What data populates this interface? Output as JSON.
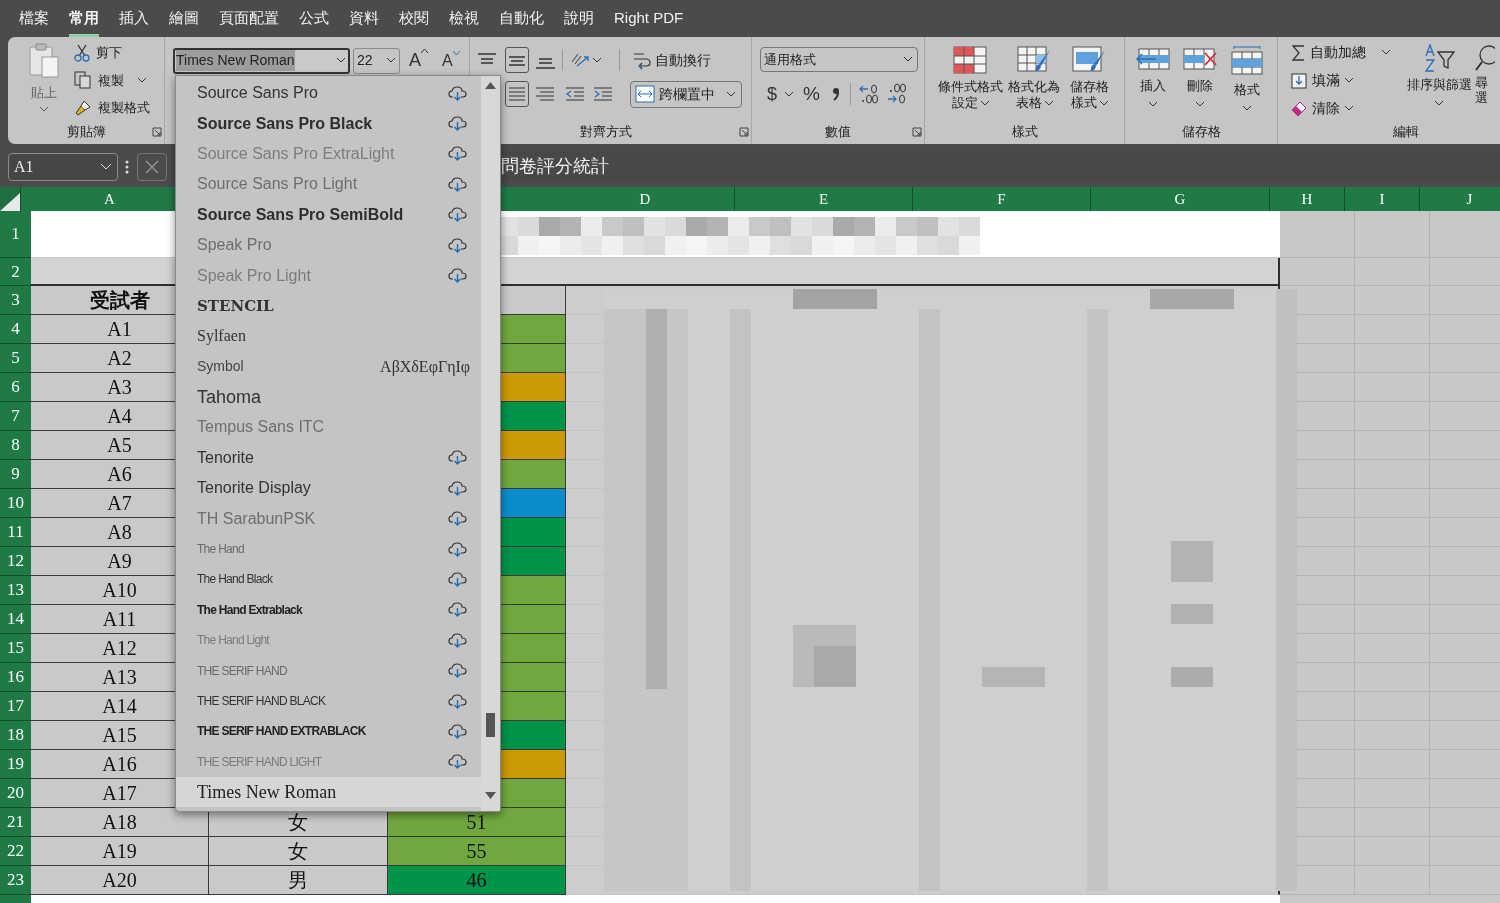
{
  "menu_tabs": [
    {
      "label": "檔案",
      "selected": false
    },
    {
      "label": "常用",
      "selected": true
    },
    {
      "label": "插入",
      "selected": false
    },
    {
      "label": "繪圖",
      "selected": false
    },
    {
      "label": "頁面配置",
      "selected": false
    },
    {
      "label": "公式",
      "selected": false
    },
    {
      "label": "資料",
      "selected": false
    },
    {
      "label": "校閱",
      "selected": false
    },
    {
      "label": "檢視",
      "selected": false
    },
    {
      "label": "自動化",
      "selected": false
    },
    {
      "label": "說明",
      "selected": false
    },
    {
      "label": "Right PDF",
      "selected": false
    }
  ],
  "ribbon": {
    "clipboard": {
      "paste": "貼上",
      "cut": "剪下",
      "copy": "複製",
      "format_painter": "複製格式",
      "label": "剪貼簿"
    },
    "font": {
      "font_name": "Times New Roman",
      "font_size": "22",
      "grow_font": "A",
      "shrink_font": "A"
    },
    "alignment": {
      "wrap_text": "自動換行",
      "merge_center": "跨欄置中",
      "label": "對齊方式"
    },
    "number": {
      "format": "通用格式",
      "currency": "$",
      "percent": "%",
      "label": "數值"
    },
    "styles": {
      "buttons": [
        {
          "lines": [
            "條件式格式",
            "設定"
          ]
        },
        {
          "lines": [
            "格式化為",
            "表格"
          ]
        },
        {
          "lines": [
            "儲存格",
            "樣式"
          ]
        }
      ],
      "label": "樣式"
    },
    "cells": {
      "buttons": [
        "插入",
        "刪除",
        "格式"
      ],
      "label": "儲存格"
    },
    "editing": {
      "autosum": "自動加總",
      "fill": "填滿",
      "clear": "清除",
      "sort_filter": "排序與篩選",
      "find_select": [
        "尋",
        "選"
      ],
      "label": "編輯"
    }
  },
  "formula_bar": {
    "name_box": "A1",
    "formula": "問卷評分統計"
  },
  "columns": [
    "A",
    "D",
    "E",
    "F",
    "G",
    "H",
    "I",
    "J"
  ],
  "rows": [
    {
      "number": "1"
    },
    {
      "number": "2"
    },
    {
      "number": "3",
      "a": "受試者"
    },
    {
      "number": "4",
      "a": "A1",
      "color": "#70a83f"
    },
    {
      "number": "5",
      "a": "A2",
      "color": "#70a83f"
    },
    {
      "number": "6",
      "a": "A3",
      "color": "#cc9a06"
    },
    {
      "number": "7",
      "a": "A4",
      "color": "#00934a"
    },
    {
      "number": "8",
      "a": "A5",
      "color": "#cc9a06"
    },
    {
      "number": "9",
      "a": "A6",
      "color": "#70a83f"
    },
    {
      "number": "10",
      "a": "A7",
      "color": "#0a8dca"
    },
    {
      "number": "11",
      "a": "A8",
      "color": "#00934a"
    },
    {
      "number": "12",
      "a": "A9",
      "color": "#00934a"
    },
    {
      "number": "13",
      "a": "A10",
      "color": "#70a83f"
    },
    {
      "number": "14",
      "a": "A11",
      "color": "#70a83f"
    },
    {
      "number": "15",
      "a": "A12",
      "color": "#70a83f"
    },
    {
      "number": "16",
      "a": "A13",
      "color": "#70a83f"
    },
    {
      "number": "17",
      "a": "A14",
      "color": "#70a83f"
    },
    {
      "number": "18",
      "a": "A15",
      "color": "#00934a"
    },
    {
      "number": "19",
      "a": "A16",
      "color": "#cc9a06"
    },
    {
      "number": "20",
      "a": "A17",
      "color": "#70a83f"
    },
    {
      "number": "21",
      "a": "A18",
      "b": "女",
      "c": "51",
      "color": "#70a83f"
    },
    {
      "number": "22",
      "a": "A19",
      "b": "女",
      "c": "55",
      "color": "#70a83f"
    },
    {
      "number": "23",
      "a": "A20",
      "b": "男",
      "c": "46",
      "color": "#00934a"
    }
  ],
  "font_dropdown": {
    "items": [
      {
        "name": "Source Sans Pro",
        "kind": "regular",
        "cloud": true,
        "selected": false
      },
      {
        "name": "Source Sans Pro Black",
        "kind": "bold",
        "cloud": true,
        "selected": false
      },
      {
        "name": "Source Sans Pro ExtraLight",
        "kind": "faint",
        "cloud": true,
        "selected": false
      },
      {
        "name": "Source Sans Pro Light",
        "kind": "light",
        "cloud": true,
        "selected": false
      },
      {
        "name": "Source Sans Pro SemiBold",
        "kind": "bold",
        "cloud": true,
        "selected": false
      },
      {
        "name": "Speak Pro",
        "kind": "light",
        "cloud": true,
        "selected": false
      },
      {
        "name": "Speak Pro Light",
        "kind": "faint",
        "cloud": true,
        "selected": false
      },
      {
        "name": "STENCIL",
        "kind": "stencil",
        "cloud": false,
        "selected": false
      },
      {
        "name": "Sylfaen",
        "kind": "serif",
        "cloud": false,
        "selected": false
      },
      {
        "name": "Symbol",
        "kind": "small",
        "cloud": false,
        "preview": "ΑβΧδΕφΓηΙφ",
        "selected": false
      },
      {
        "name": "Tahoma",
        "kind": "large",
        "cloud": false,
        "selected": false
      },
      {
        "name": "Tempus Sans ITC",
        "kind": "light",
        "cloud": false,
        "selected": false
      },
      {
        "name": "Tenorite",
        "kind": "regular",
        "cloud": true,
        "selected": false
      },
      {
        "name": "Tenorite Display",
        "kind": "regular",
        "cloud": true,
        "selected": false
      },
      {
        "name": "TH SarabunPSK",
        "kind": "light",
        "cloud": true,
        "selected": false
      },
      {
        "name": "The Hand",
        "kind": "condensed-faint",
        "cloud": true,
        "selected": false
      },
      {
        "name": "The Hand Black",
        "kind": "condensed",
        "cloud": true,
        "selected": false
      },
      {
        "name": "The Hand Extrablack",
        "kind": "condensed-bold",
        "cloud": true,
        "selected": false
      },
      {
        "name": "The Hand Light",
        "kind": "condensed-ghost",
        "cloud": true,
        "selected": false
      },
      {
        "name": "THE SERIF HAND",
        "kind": "condensed-faint",
        "cloud": true,
        "selected": false
      },
      {
        "name": "THE SERIF HAND BLACK",
        "kind": "condensed",
        "cloud": true,
        "selected": false
      },
      {
        "name": "THE SERIF HAND EXTRABLACK",
        "kind": "condensed-bold",
        "cloud": true,
        "selected": false
      },
      {
        "name": "THE SERIF HAND LIGHT",
        "kind": "condensed-ghost",
        "cloud": true,
        "selected": false
      },
      {
        "name": "Times New Roman",
        "kind": "serif-large",
        "cloud": false,
        "selected": true
      }
    ]
  }
}
